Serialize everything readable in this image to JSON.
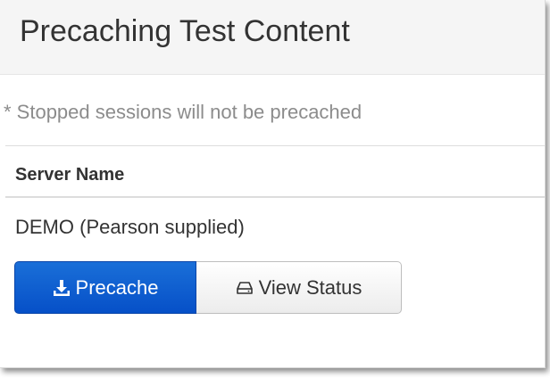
{
  "header": {
    "title": "Precaching Test Content"
  },
  "note": "* Stopped sessions will not be precached",
  "table": {
    "columns": [
      "Server Name"
    ],
    "rows": [
      {
        "server_name": "DEMO (Pearson supplied)"
      }
    ]
  },
  "actions": {
    "precache_label": "Precache",
    "precache_icon": "download-icon",
    "view_status_label": "View Status",
    "view_status_icon": "hdd-icon"
  },
  "colors": {
    "primary": "#0650c8",
    "header_bg": "#f5f5f5",
    "muted_text": "#8c8c8c"
  }
}
